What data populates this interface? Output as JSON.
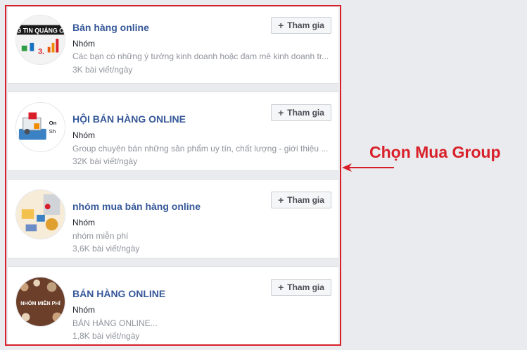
{
  "groups": [
    {
      "name": "Bán hàng online",
      "type": "Nhóm",
      "description": "Các bạn có những ý tưởng kinh doanh hoặc đam mê kinh doanh tr...",
      "posts": "3K bài viết/ngày",
      "join_label": "Tham gia",
      "avatar_text": "G TIN QUẢNG C"
    },
    {
      "name": "HỘI BÁN HÀNG ONLINE",
      "type": "Nhóm",
      "description": "Group chuyên bán những sản phẩm uy tín, chất lượng - giới thiệu ...",
      "posts": "32K bài viết/ngày",
      "join_label": "Tham gia",
      "avatar_text": "On Sh"
    },
    {
      "name": "nhóm mua bán hàng online",
      "type": "Nhóm",
      "description": "nhóm miễn phí",
      "posts": "3,6K bài viết/ngày",
      "join_label": "Tham gia",
      "avatar_text": ""
    },
    {
      "name": "BÁN HÀNG ONLINE",
      "type": "Nhóm",
      "description": "BÁN HÀNG ONLINE...",
      "posts": "1,8K bài viết/ngày",
      "join_label": "Tham gia",
      "avatar_text": "NHÓM MIỄN PHÍ"
    }
  ],
  "annotation": {
    "text": "Chọn Mua Group",
    "color": "#d9202a"
  },
  "colors": {
    "link": "#365899",
    "accent_red": "#d9202a",
    "page_bg": "#e9ebee"
  },
  "icons": {
    "join": "plus-icon",
    "annotation": "arrow-left-icon"
  }
}
